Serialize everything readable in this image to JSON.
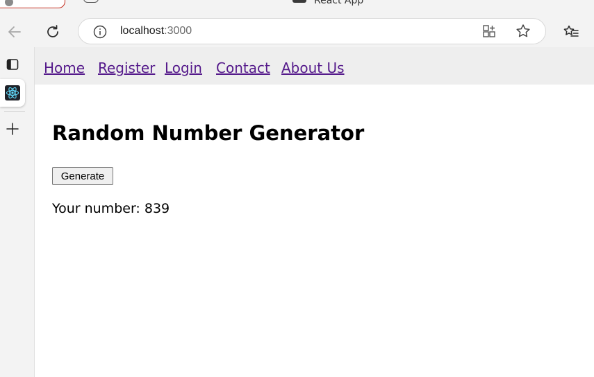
{
  "browser": {
    "tab_title": "React App",
    "address": {
      "host": "localhost",
      "port": ":3000"
    }
  },
  "nav": {
    "links": [
      "Home",
      "Register",
      "Login",
      "Contact",
      "About Us"
    ]
  },
  "page": {
    "title": "Random Number Generator",
    "button_label": "Generate",
    "result_label": "Your number: ",
    "result_value": "839"
  },
  "colors": {
    "link_visited": "#551a8b",
    "navbar_bg": "#eeeeee",
    "react_logo": "#00a3d9"
  },
  "icons": {
    "back": "arrow-left-icon",
    "refresh": "refresh-icon",
    "info": "info-icon",
    "extensions": "extensions-icon",
    "favorite": "star-icon",
    "favorites_list": "favorites-icon",
    "panel": "tab-panel-icon",
    "react": "react-logo-icon",
    "new_tab": "plus-icon"
  }
}
